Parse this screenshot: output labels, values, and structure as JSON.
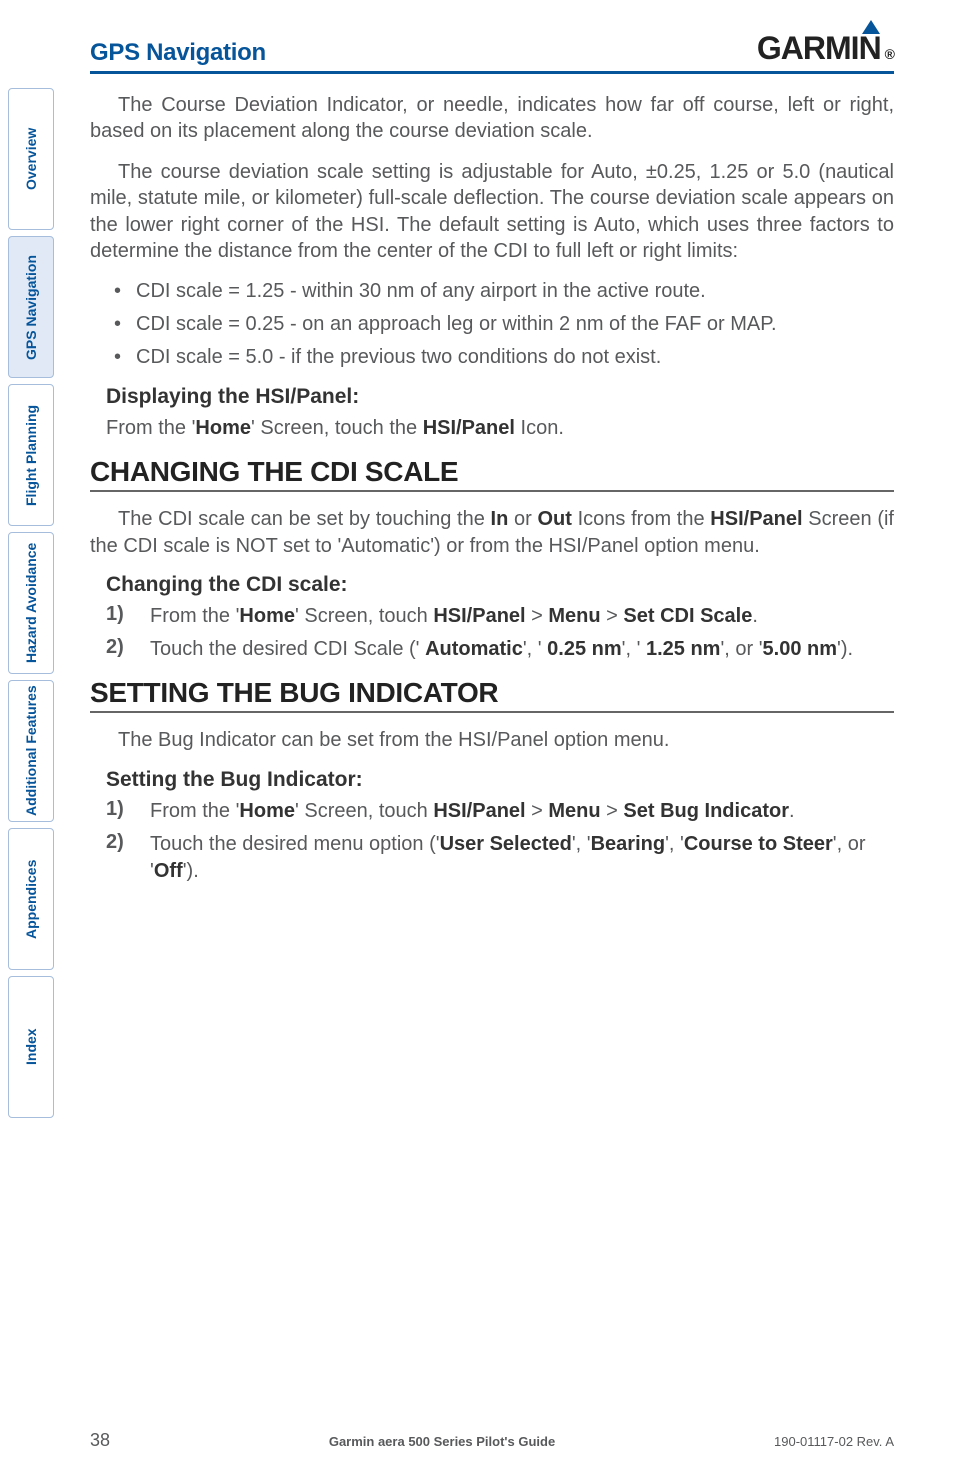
{
  "header": {
    "title": "GPS Navigation"
  },
  "logo": {
    "text": "GARMIN",
    "reg": "®"
  },
  "tabs": [
    {
      "label": "Overview"
    },
    {
      "label": "GPS Navigation"
    },
    {
      "label": "Flight Planning"
    },
    {
      "label": "Hazard Avoidance"
    },
    {
      "label": "Additional Features"
    },
    {
      "label": "Appendices"
    },
    {
      "label": "Index"
    }
  ],
  "para1": "The Course Deviation Indicator, or needle, indicates how far off course, left or right, based on its placement along the course deviation scale.",
  "para2": "The course deviation scale setting is adjustable for Auto, ±0.25, 1.25 or 5.0 (nautical mile, statute mile, or kilometer) full-scale deflection.  The course deviation scale appears on the lower right corner of the HSI.  The default setting is Auto, which uses three factors to determine the distance from the center of the CDI to full left or right limits:",
  "bullets": [
    "CDI scale = 1.25 - within 30 nm of any airport in the active route.",
    "CDI scale = 0.25 - on an approach leg or within 2 nm of the FAF or MAP.",
    "CDI scale = 5.0 - if the previous two conditions do not exist."
  ],
  "sec1": {
    "head": "Displaying the HSI/Panel:",
    "line_a": "From the '",
    "line_b": "Home",
    "line_c": "' Screen, touch the ",
    "line_d": "HSI/Panel",
    "line_e": " Icon."
  },
  "h2a": "CHANGING THE CDI SCALE",
  "para3a": "The CDI scale can be set by touching the ",
  "para3b": "In",
  "para3c": " or ",
  "para3d": "Out",
  "para3e": " Icons from the ",
  "para3f": "HSI/Panel",
  "para3g": " Screen (if the CDI scale is NOT set to 'Automatic') or from the HSI/Panel option menu.",
  "sec2": {
    "head": "Changing the CDI scale:",
    "n1": "1)",
    "s1a": "From the '",
    "s1b": "Home",
    "s1c": "' Screen, touch ",
    "s1d": "HSI/Panel",
    "s1e": " > ",
    "s1f": "Menu",
    "s1g": " > ",
    "s1h": "Set CDI Scale",
    "s1i": ".",
    "n2": "2)",
    "s2a": "Touch the desired CDI Scale (' ",
    "s2b": "Automatic",
    "s2c": "', ' ",
    "s2d": "0.25 nm",
    "s2e": "', ' ",
    "s2f": "1.25 nm",
    "s2g": "', or '",
    "s2h": "5.00 nm",
    "s2i": "')."
  },
  "h2b": "SETTING THE BUG INDICATOR",
  "para4": "The Bug Indicator can be set from the HSI/Panel option menu.",
  "sec3": {
    "head": "Setting the Bug Indicator:",
    "n1": "1)",
    "s1a": "From the '",
    "s1b": "Home",
    "s1c": "' Screen, touch ",
    "s1d": "HSI/Panel",
    "s1e": " > ",
    "s1f": "Menu",
    "s1g": " > ",
    "s1h": "Set Bug Indicator",
    "s1i": ".",
    "n2": "2)",
    "s2a": "Touch the desired menu option ('",
    "s2b": "User Selected",
    "s2c": "', '",
    "s2d": "Bearing",
    "s2e": "', '",
    "s2f": "Course to Steer",
    "s2g": "', or '",
    "s2h": "Off",
    "s2i": "')."
  },
  "footer": {
    "page": "38",
    "center": "Garmin aera 500 Series Pilot's Guide",
    "rev": "190-01117-02  Rev. A"
  }
}
